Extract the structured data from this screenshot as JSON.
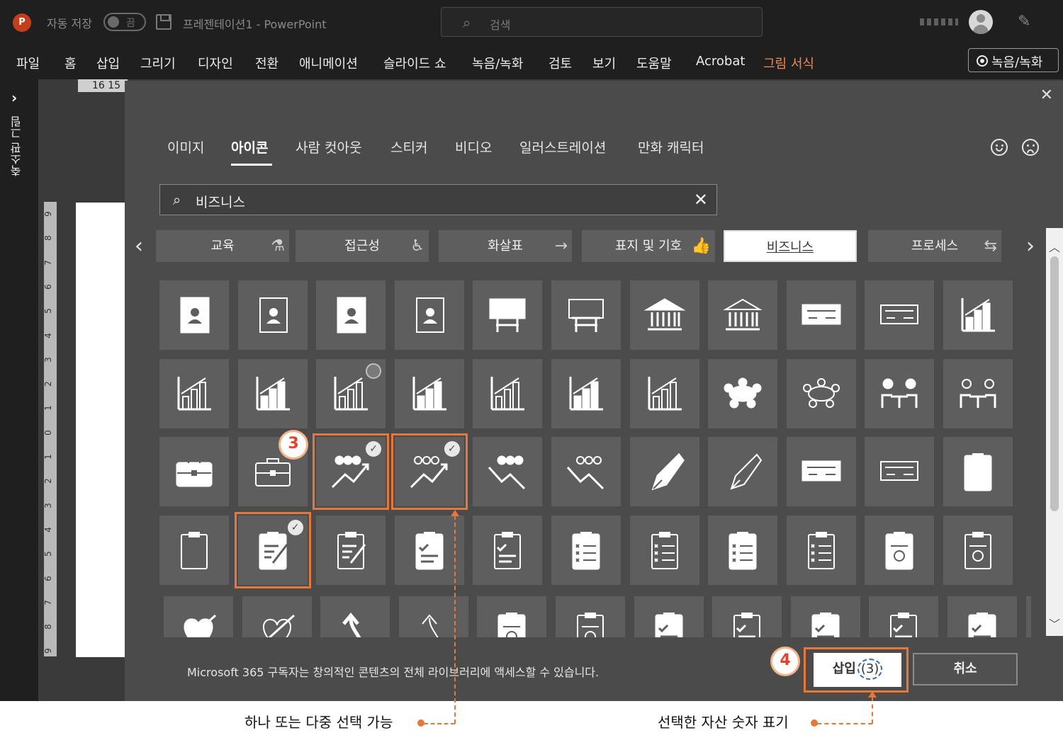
{
  "titlebar": {
    "app_logo": "P",
    "autosave_label": "자동 저장",
    "autosave_state": "끔",
    "doc_title": "프레젠테이션1  -  PowerPoint",
    "search_placeholder": "검색"
  },
  "ribbon": {
    "tabs": [
      "파일",
      "홈",
      "삽입",
      "그리기",
      "디자인",
      "전환",
      "애니메이션",
      "슬라이드 쇼",
      "녹음/녹화",
      "검토",
      "보기",
      "도움말",
      "Acrobat",
      "그림 서식"
    ],
    "accent_tab": "그림 서식",
    "record_button": "녹음/녹화"
  },
  "left_pane": {
    "label": "축소판 그림"
  },
  "ruler": {
    "horizontal": "16  15",
    "vertical": [
      "9",
      "8",
      "7",
      "6",
      "5",
      "4",
      "3",
      "2",
      "1",
      "0",
      "1",
      "2",
      "3",
      "4",
      "5",
      "6",
      "7",
      "8",
      "9"
    ]
  },
  "dialog": {
    "categories": [
      "이미지",
      "아이콘",
      "사람 컷아웃",
      "스티커",
      "비디오",
      "일러스트레이션",
      "만화 캐릭터"
    ],
    "active_category": "아이콘",
    "search_value": "비즈니스",
    "chips": [
      {
        "label": "교육",
        "deco": "⚗"
      },
      {
        "label": "접근성",
        "deco": "♿"
      },
      {
        "label": "화살표",
        "deco": "→"
      },
      {
        "label": "표지 및 기호",
        "deco": "👍"
      },
      {
        "label": "비즈니스",
        "deco": ""
      },
      {
        "label": "프로세스",
        "deco": "⇆"
      }
    ],
    "active_chip": "비즈니스",
    "footer_note": "Microsoft 365 구독자는 창의적인 콘텐츠의 전체 라이브러리에 액세스할 수 있습니다.",
    "insert_label": "삽입",
    "insert_count": "(3)",
    "cancel_label": "취소",
    "selected_count": 3
  },
  "icons": [
    [
      "contact-book-filled",
      "contact-book-outline",
      "contact-book-filled-2",
      "contact-book-outline-2",
      "billboard-filled",
      "billboard-outline",
      "bank-filled",
      "bank-outline",
      "check-filled",
      "check-outline",
      "bar-chart-down-filled"
    ],
    [
      "bar-chart-down-outline",
      "bar-chart-up-filled",
      "bar-chart-up-outline",
      "bar-chart-rise-filled",
      "bar-chart-rise-outline",
      "bar-chart-fall-filled",
      "bar-chart-fall-outline",
      "meeting-table-filled",
      "meeting-table-outline",
      "interview-filled",
      "interview-outline"
    ],
    [
      "briefcase-filled",
      "briefcase-outline",
      "team-growth-filled",
      "team-growth-outline",
      "team-decline-filled",
      "team-decline-outline",
      "fountain-pen-filled",
      "fountain-pen-outline",
      "checklist-filled",
      "checklist-outline",
      "clipboard-filled"
    ],
    [
      "clipboard-outline",
      "clipboard-edit-filled",
      "clipboard-edit-outline",
      "clipboard-check-filled",
      "clipboard-check-outline",
      "clipboard-list-x-filled",
      "clipboard-list-x-outline",
      "clipboard-list-x-filled-2",
      "clipboard-list-x-outline-2",
      "clipboard-badge-filled",
      "clipboard-badge-outline"
    ],
    [
      "heart-arrow-filled",
      "heart-arrow-outline",
      "curved-arrow-filled",
      "curved-arrow-outline",
      "clipboard-id-filled",
      "clipboard-id-outline",
      "clipboard-checklist-filled",
      "clipboard-checklist-outline",
      "clipboard-checklist-filled-2",
      "clipboard-checklist-outline-2",
      "clipboard-checklist-filled-3",
      "clipboard-checklist-outline-3"
    ]
  ],
  "annotations": {
    "badge_select": "3",
    "badge_insert": "4",
    "caption_select": "하나 또는 다중 선택 가능",
    "caption_count": "선택한 자산 숫자 표기"
  }
}
